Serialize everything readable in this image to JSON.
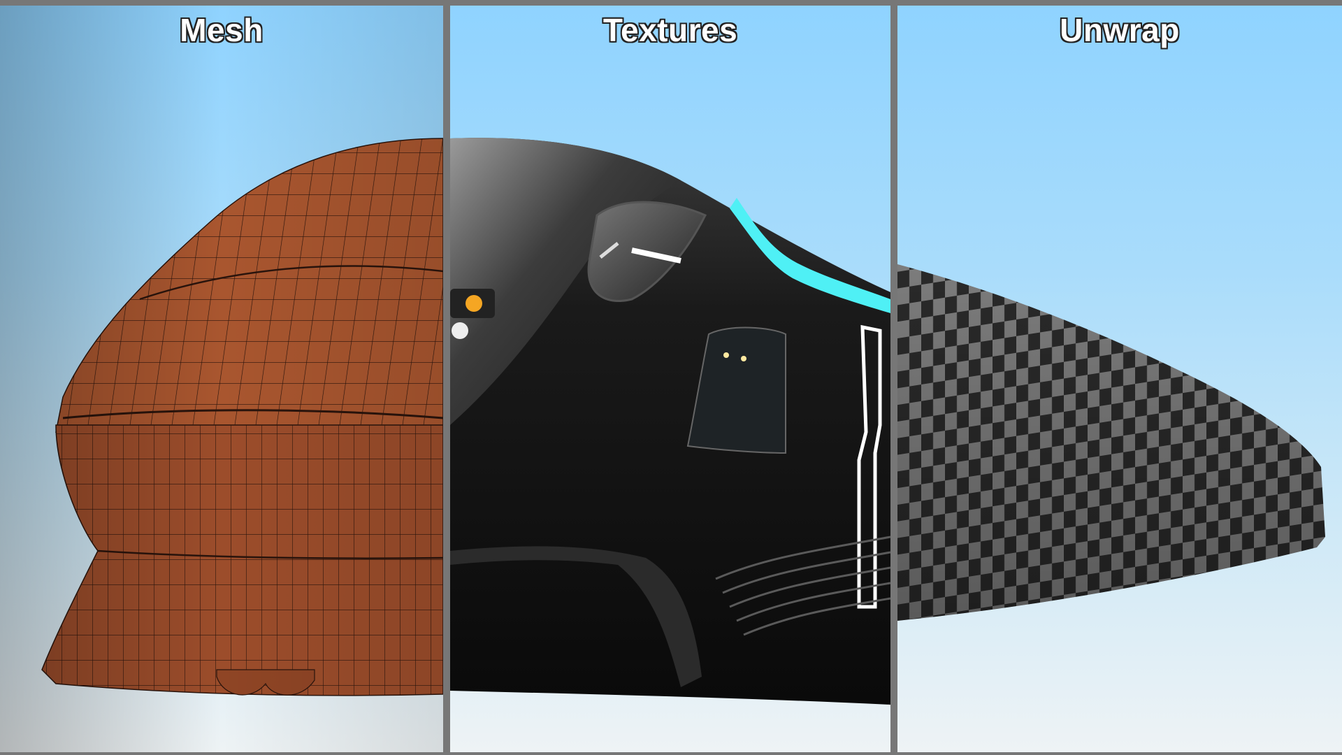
{
  "panels": [
    {
      "title": "Mesh"
    },
    {
      "title": "Textures"
    },
    {
      "title": "Unwrap"
    }
  ],
  "colors": {
    "mesh_surface": "#a0522d",
    "mesh_wire": "#2a140c",
    "body_black": "#111111",
    "accent_cyan": "#4ff0f5",
    "checker_light": "#8a8a8a",
    "checker_dark": "#2e2e2e",
    "divider": "#777777"
  }
}
